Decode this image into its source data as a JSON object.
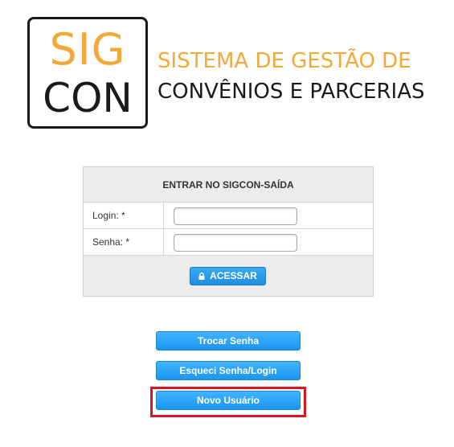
{
  "logo": {
    "mark_top": "SIG",
    "mark_bottom": "CON",
    "line1": "SISTEMA DE GESTÃO DE",
    "line2": "CONVÊNIOS E PARCERIAS",
    "color_orange": "#f2a93a",
    "color_dark": "#1a1a1a"
  },
  "login": {
    "title": "ENTRAR NO SIGCON-SAÍDA",
    "login_label": "Login: *",
    "login_value": "",
    "login_placeholder": "",
    "senha_label": "Senha: *",
    "senha_value": "",
    "senha_placeholder": "",
    "submit_label": "ACESSAR",
    "submit_icon": "lock-icon"
  },
  "actions": {
    "trocar_senha": "Trocar Senha",
    "esqueci_senha": "Esqueci Senha/Login",
    "novo_usuario": "Novo Usuário"
  },
  "colors": {
    "button_blue": "#1c95f0",
    "highlight_red": "#e0141f",
    "panel_gray": "#ececec"
  }
}
